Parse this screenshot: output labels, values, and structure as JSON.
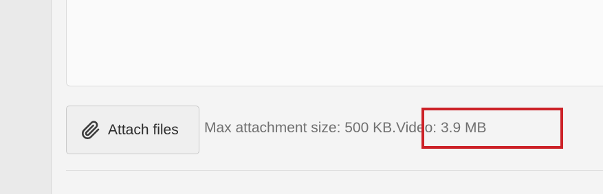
{
  "composer": {
    "textarea_value": ""
  },
  "attachment": {
    "button_label": "Attach files",
    "button_icon": "paperclip-icon",
    "limit_text": "Max attachment size: 500 KB.",
    "video_text": "Video: 3.9 MB"
  },
  "colors": {
    "highlight": "#cc2127",
    "info_text": "#707070"
  }
}
